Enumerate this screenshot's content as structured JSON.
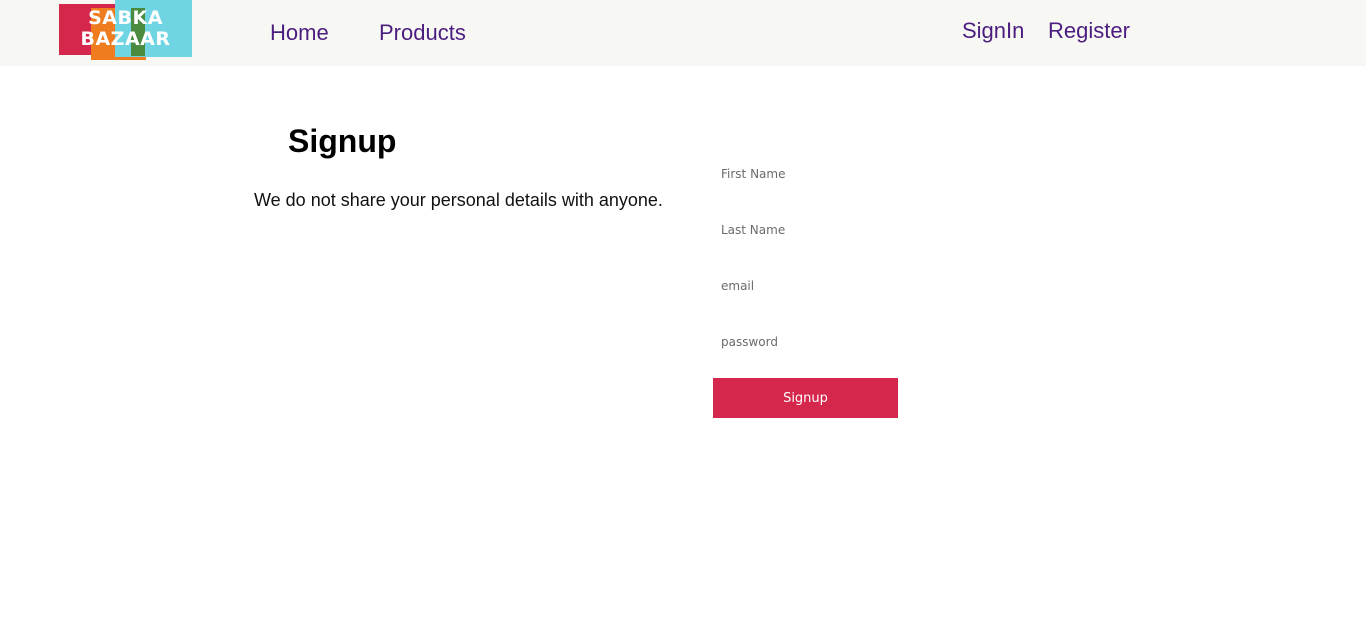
{
  "header": {
    "logo": {
      "line1": "SABKA",
      "line2": "BAZAAR"
    },
    "nav": {
      "home": "Home",
      "products": "Products"
    },
    "auth": {
      "signin": "SignIn",
      "register": "Register"
    }
  },
  "main": {
    "title": "Signup",
    "subtitle": "We do not share your personal details with anyone.",
    "form": {
      "first_name": {
        "placeholder": "First Name",
        "value": ""
      },
      "last_name": {
        "placeholder": "Last Name",
        "value": ""
      },
      "email": {
        "placeholder": "email",
        "value": ""
      },
      "password": {
        "placeholder": "password",
        "value": ""
      },
      "submit_label": "Signup"
    }
  },
  "colors": {
    "header_bg": "#f7f7f3",
    "nav_text": "#4c1d80",
    "accent": "#d5264b",
    "logo_red": "#d5274b",
    "logo_orange": "#f07c20",
    "logo_cyan": "#6fd5e3",
    "logo_green": "#4a8b3f"
  }
}
